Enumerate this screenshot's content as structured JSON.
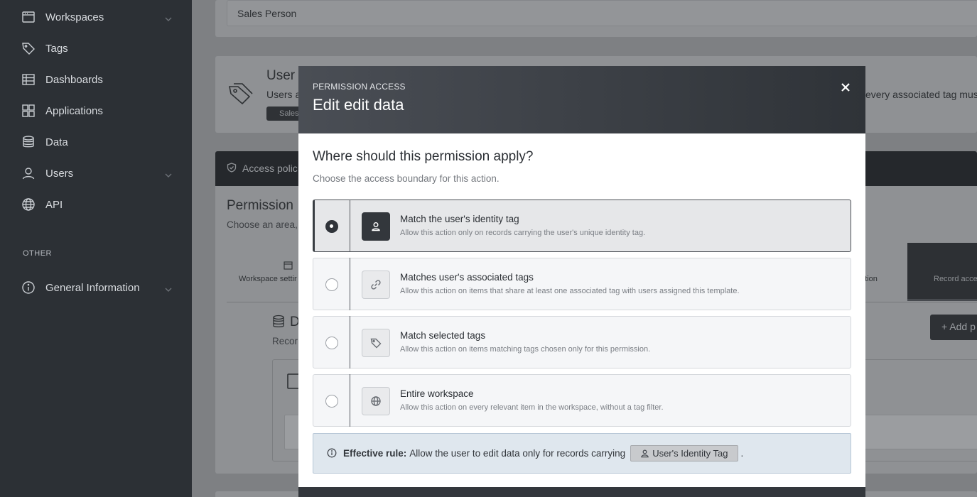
{
  "sidebar": {
    "items": [
      {
        "label": "Workspaces",
        "icon": "window-icon",
        "chevron": true
      },
      {
        "label": "Tags",
        "icon": "tag-icon",
        "chevron": false
      },
      {
        "label": "Dashboards",
        "icon": "table-icon",
        "chevron": false
      },
      {
        "label": "Applications",
        "icon": "grid-icon",
        "chevron": false
      },
      {
        "label": "Data",
        "icon": "database-icon",
        "chevron": false
      },
      {
        "label": "Users",
        "icon": "user-icon",
        "chevron": true
      },
      {
        "label": "API",
        "icon": "globe-icon",
        "chevron": false
      }
    ],
    "section_other": "OTHER",
    "other_items": [
      {
        "label": "General Information",
        "icon": "info-icon",
        "chevron": true
      }
    ]
  },
  "background": {
    "input_value": "Sales Person",
    "user_card_title": "User",
    "user_card_text": "Users a",
    "user_card_text_right": "every associated tag mus",
    "user_card_badge": "Sales",
    "access_bar_label": "Access polic",
    "permission_title": "Permission",
    "permission_sub": "Choose an area,",
    "tab_workspace": "Workspace settir",
    "tab_ation": "ation",
    "tab_record": "Record acce",
    "data_heading": "D",
    "data_sub": "Recor",
    "add_button": "Add p"
  },
  "modal": {
    "kicker": "PERMISSION ACCESS",
    "title": "Edit edit data",
    "question": "Where should this permission apply?",
    "subtitle": "Choose the access boundary for this action.",
    "options": [
      {
        "title": "Match the user's identity tag",
        "desc": "Allow this action only on records carrying the user's unique identity tag.",
        "icon": "user-icon",
        "selected": true
      },
      {
        "title": "Matches user's associated tags",
        "desc": "Allow this action on items that share at least one associated tag with users assigned this template.",
        "icon": "link-icon",
        "selected": false
      },
      {
        "title": "Match selected tags",
        "desc": "Allow this action on items matching tags chosen only for this permission.",
        "icon": "tag-icon",
        "selected": false
      },
      {
        "title": "Entire workspace",
        "desc": "Allow this action on every relevant item in the workspace, without a tag filter.",
        "icon": "globe-icon",
        "selected": false
      }
    ],
    "rule": {
      "label": "Effective rule:",
      "text": "Allow the user to edit data only for records carrying",
      "chip": "User's Identity Tag",
      "end": "."
    }
  }
}
